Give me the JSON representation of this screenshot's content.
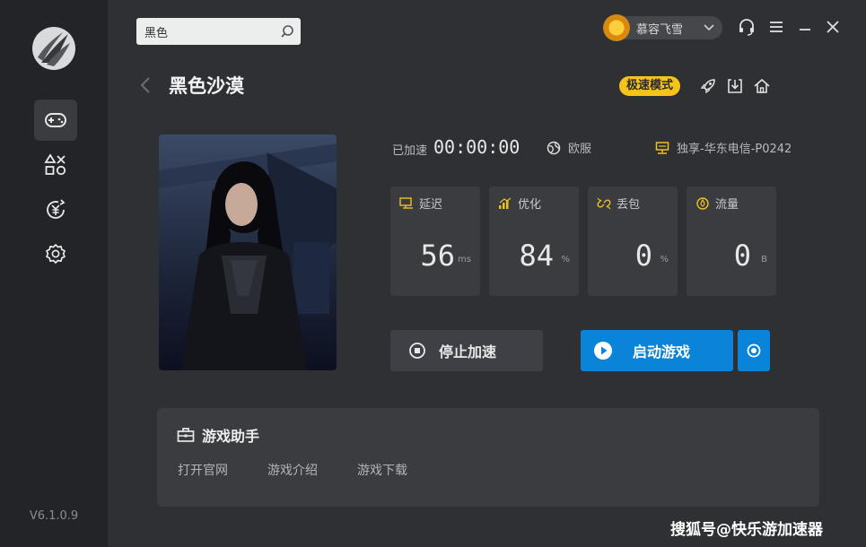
{
  "app": {
    "version": "V6.1.0.9"
  },
  "search": {
    "value": "黑色",
    "placeholder": ""
  },
  "user": {
    "name": "慕容飞雪"
  },
  "game": {
    "title": "黑色沙漠",
    "mode_badge": "极速模式",
    "status": {
      "accelerated_label": "已加速",
      "elapsed_time": "00:00:00",
      "region": "欧服",
      "node": "独享-华东电信-P0242"
    },
    "stats": [
      {
        "label": "延迟",
        "value": "56",
        "unit": "ms",
        "icon": "latency-icon"
      },
      {
        "label": "优化",
        "value": "84",
        "unit": "%",
        "icon": "signal-icon"
      },
      {
        "label": "丢包",
        "value": "0",
        "unit": "%",
        "icon": "packet-loss-icon"
      },
      {
        "label": "流量",
        "value": "0",
        "unit": "B",
        "icon": "traffic-icon"
      }
    ],
    "stop_button": "停止加速",
    "start_button": "启动游戏"
  },
  "helper": {
    "title": "游戏助手",
    "links": [
      "打开官网",
      "游戏介绍",
      "游戏下载"
    ]
  },
  "watermark": "搜狐号@快乐游加速器",
  "colors": {
    "background": "#2e3033",
    "sidebar": "#232427",
    "card": "#3a3c40",
    "accent_blue": "#0a84d8",
    "badge_yellow": "#f5c31c"
  }
}
